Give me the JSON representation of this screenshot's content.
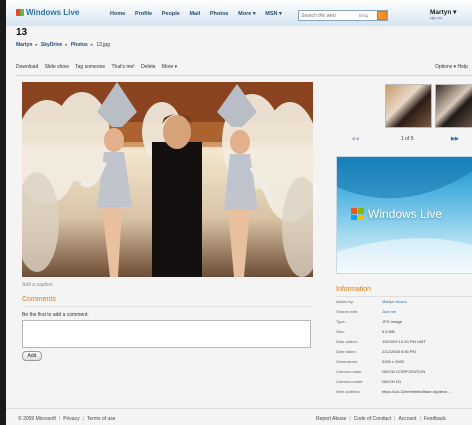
{
  "header": {
    "logo": "Windows Live",
    "nav": [
      "Home",
      "Profile",
      "People",
      "Mail",
      "Photos",
      "More ▾",
      "MSN ▾"
    ],
    "search_placeholder": "Search the web",
    "search_engine": "Bing",
    "user_name": "Martyn ▾",
    "user_sub": "sign out"
  },
  "page": {
    "title": "13",
    "breadcrumb": [
      "Martyn",
      "SkyDrive",
      "Photos",
      "13.jpg"
    ]
  },
  "toolbar": {
    "items": [
      "Download",
      "Slide show",
      "Tag someone",
      "That's me!",
      "Delete",
      "More ▾"
    ],
    "options": "Options ▾",
    "help": "Help"
  },
  "photo": {
    "caption_placeholder": "Add a caption"
  },
  "comments": {
    "heading": "Comments",
    "prompt": "Be the first to add a comment:",
    "add_button": "Add"
  },
  "pager": {
    "prev": "◀◀",
    "count": "1 of 5",
    "next": "▶▶"
  },
  "ad": {
    "text": "Windows Live"
  },
  "info": {
    "heading": "Information",
    "rows": [
      {
        "label": "Added by:",
        "value": "Martyn Moore"
      },
      {
        "label": "Shared with:",
        "value": "Just me"
      },
      {
        "label": "Type:",
        "value": "JPG Image"
      },
      {
        "label": "Size:",
        "value": "6.6 MB"
      },
      {
        "label": "Date added:",
        "value": "1/5/2009 10:33 PM GMT"
      },
      {
        "label": "Date taken:",
        "value": "2/12/2008 6:36 PM"
      },
      {
        "label": "Dimensions:",
        "value": "3250 x 2602"
      },
      {
        "label": "Camera make:",
        "value": "NIKON CORPORATION"
      },
      {
        "label": "Camera model:",
        "value": "NIKON D3"
      },
      {
        "label": "Web address:",
        "value": "https://cid-32ee9efefbd0bae.skydrive..."
      }
    ]
  },
  "footer": {
    "left": [
      "© 2009 Microsoft",
      "Privacy",
      "Terms of use"
    ],
    "right": [
      "Report Abuse",
      "Code of Conduct",
      "Account",
      "Feedback"
    ]
  },
  "colors": {
    "accent_orange": "#e07b1a",
    "link_blue": "#2b6fae",
    "nav_text": "#2a4a70"
  }
}
